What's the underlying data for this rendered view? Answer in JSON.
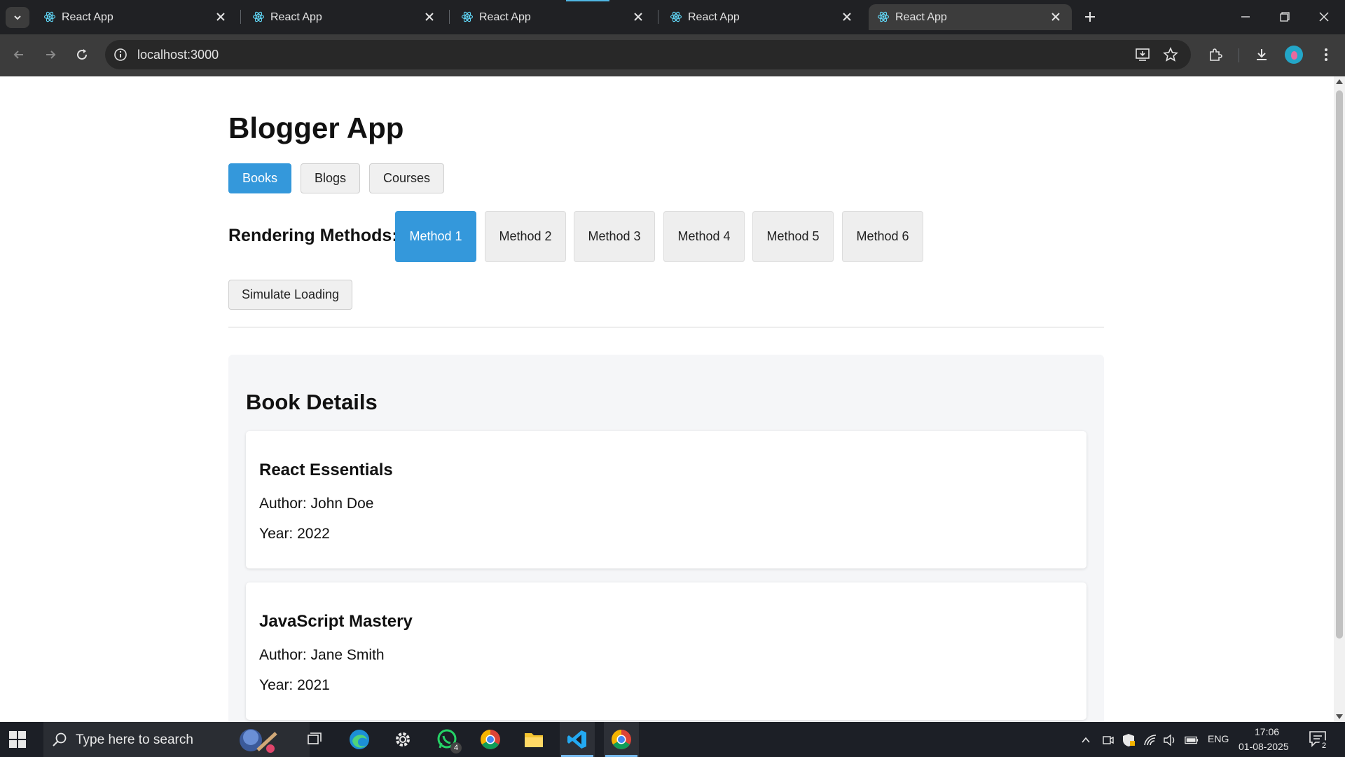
{
  "browser": {
    "tabs": [
      {
        "title": "React App",
        "active": false
      },
      {
        "title": "React App",
        "active": false
      },
      {
        "title": "React App",
        "active": false
      },
      {
        "title": "React App",
        "active": false
      },
      {
        "title": "React App",
        "active": true
      }
    ],
    "url": "localhost:3000"
  },
  "app": {
    "title": "Blogger App",
    "nav": [
      {
        "label": "Books",
        "active": true
      },
      {
        "label": "Blogs",
        "active": false
      },
      {
        "label": "Courses",
        "active": false
      }
    ],
    "rendering_label": "Rendering Methods:",
    "methods": [
      {
        "label": "Method 1",
        "active": true
      },
      {
        "label": "Method 2",
        "active": false
      },
      {
        "label": "Method 3",
        "active": false
      },
      {
        "label": "Method 4",
        "active": false
      },
      {
        "label": "Method 5",
        "active": false
      },
      {
        "label": "Method 6",
        "active": false
      }
    ],
    "simulate_label": "Simulate Loading",
    "details_title": "Book Details",
    "books": [
      {
        "title": "React Essentials",
        "author": "Author: John Doe",
        "year": "Year: 2022"
      },
      {
        "title": "JavaScript Mastery",
        "author": "Author: Jane Smith",
        "year": "Year: 2021"
      }
    ],
    "accent_color": "#3498db"
  },
  "taskbar": {
    "search_placeholder": "Type here to search",
    "whatsapp_badge": "4",
    "language": "ENG",
    "time": "17:06",
    "date": "01-08-2025",
    "notification_count": "2",
    "apps": [
      "copilot-icon",
      "task-view-icon",
      "edge-icon",
      "settings-icon",
      "whatsapp-icon",
      "chrome-icon",
      "file-explorer-icon",
      "vscode-icon",
      "chrome-active-icon"
    ]
  }
}
